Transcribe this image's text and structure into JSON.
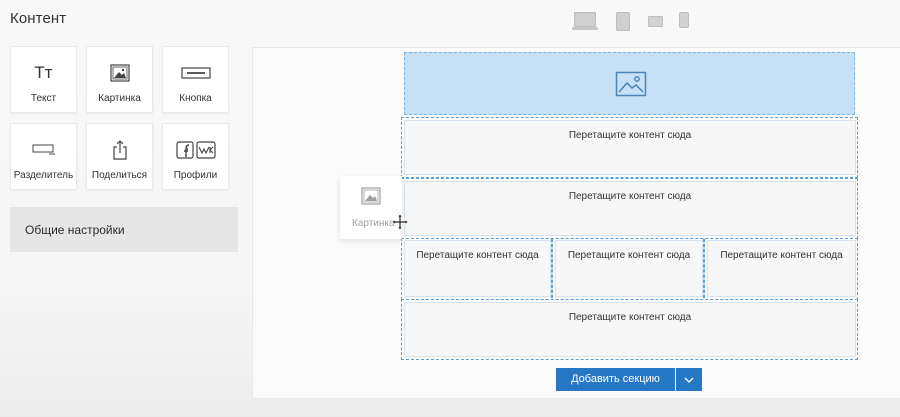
{
  "header": {
    "title": "Контент"
  },
  "devices": [
    {
      "name": "laptop-icon",
      "active": false
    },
    {
      "name": "tablet-icon",
      "active": false
    },
    {
      "name": "tablet-landscape-icon",
      "active": false
    },
    {
      "name": "phone-icon",
      "active": false
    }
  ],
  "tiles": {
    "text": {
      "label": "Текст",
      "glyph": "Тт"
    },
    "image": {
      "label": "Картинка"
    },
    "button": {
      "label": "Кнопка"
    },
    "divider": {
      "label": "Разделитель"
    },
    "share": {
      "label": "Поделиться"
    },
    "profiles": {
      "label": "Профили"
    }
  },
  "settings": {
    "label": "Общие настройки"
  },
  "canvas": {
    "drop_text": "Перетащите контент сюда",
    "drag_ghost_label": "Картинка"
  },
  "footer": {
    "add_section_label": "Добавить секцию"
  },
  "colors": {
    "accent": "#2778c4",
    "image_block_fill": "#c6e1f6",
    "outline": "#5ca0d6"
  }
}
